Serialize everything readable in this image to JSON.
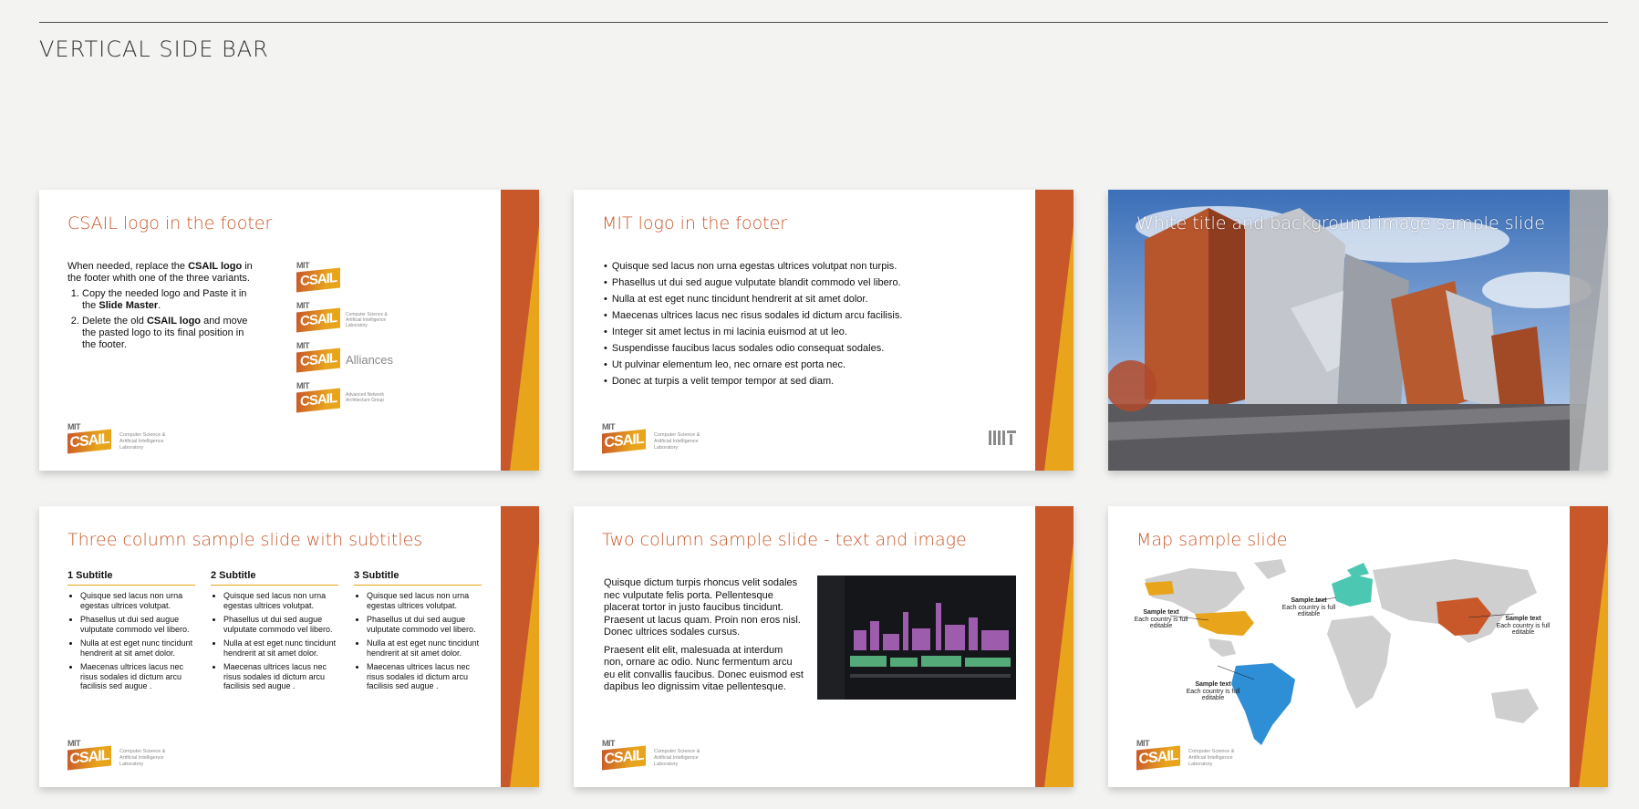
{
  "page": {
    "heading": "VERTICAL SIDE BAR"
  },
  "sidebar": {
    "colors": {
      "orange": "#c8582a",
      "yellow": "#e8a51c",
      "gray": "#a7a9ab"
    }
  },
  "logo": {
    "mit": "MIT",
    "csail": "CSAIL",
    "tagline": [
      "Computer Science &",
      "Artificial Intelligence",
      "Laboratory"
    ],
    "alliances": "Alliances",
    "advanced": [
      "Advanced Network",
      "Architecture Group"
    ]
  },
  "slides": {
    "s1": {
      "title": "CSAIL logo in the footer",
      "intro_pre": "When needed, replace the ",
      "intro_bold": "CSAIL logo",
      "intro_post": " in the footer whith one of the three variants.",
      "step1_pre": "Copy the needed logo and Paste it in the ",
      "step1_bold": "Slide Master",
      "step1_post": ".",
      "step2_pre": "Delete the old ",
      "step2_bold": "CSAIL logo",
      "step2_post": " and move the pasted logo to its final position in the footer."
    },
    "s2": {
      "title": "MIT logo in the footer",
      "bullets": [
        "Quisque sed lacus non urna egestas ultrices volutpat non turpis.",
        "Phasellus ut dui sed augue vulputate blandit commodo vel libero.",
        "Nulla at est eget nunc tincidunt hendrerit at sit amet dolor.",
        "Maecenas ultrices lacus nec risus sodales id dictum arcu facilisis.",
        "Integer sit amet lectus in mi lacinia euismod at ut leo.",
        "Suspendisse faucibus lacus sodales odio consequat sodales.",
        "Ut pulvinar elementum leo, nec ornare est porta nec.",
        "Donec at turpis a velit tempor tempor at sed diam."
      ]
    },
    "s3": {
      "title": "White title and background image sample slide"
    },
    "s4": {
      "title": "Three column sample slide with subtitles",
      "columns": [
        {
          "heading": "1 Subtitle",
          "items": [
            "Quisque sed lacus non urna egestas ultrices volutpat.",
            "Phasellus ut dui sed augue vulputate commodo vel libero.",
            "Nulla at est eget nunc tincidunt hendrerit at sit amet dolor.",
            "Maecenas ultrices lacus nec risus sodales id dictum arcu facilisis sed augue ."
          ]
        },
        {
          "heading": "2 Subtitle",
          "items": [
            "Quisque sed lacus non urna egestas ultrices volutpat.",
            "Phasellus ut dui sed augue vulputate commodo vel libero.",
            "Nulla at est eget nunc tincidunt hendrerit at sit amet dolor.",
            "Maecenas ultrices lacus nec risus sodales id dictum arcu facilisis sed augue ."
          ]
        },
        {
          "heading": "3 Subtitle",
          "items": [
            "Quisque sed lacus non urna egestas ultrices volutpat.",
            "Phasellus ut dui sed augue vulputate commodo vel libero.",
            "Nulla at est eget nunc tincidunt hendrerit at sit amet dolor.",
            "Maecenas ultrices lacus nec risus sodales id dictum arcu facilisis sed augue ."
          ]
        }
      ]
    },
    "s5": {
      "title": "Two column sample slide - text and image",
      "para1": "Quisque dictum turpis rhoncus velit sodales nec vulputate felis porta. Pellentesque placerat tortor in justo faucibus tincidunt. Praesent ut lacus quam. Proin non eros nisl. Donec ultrices sodales cursus.",
      "para2": "Praesent elit elit, malesuada at interdum non, ornare ac odio. Nunc fermentum arcu eu elit convallis faucibus. Donec euismod est dapibus leo dignissim vitae pellentesque."
    },
    "s6": {
      "title": "Map sample slide",
      "labels": [
        {
          "bold": "Sample text",
          "text": "Each country is full editable"
        },
        {
          "bold": "Sample text",
          "text": "Each country is full editable"
        },
        {
          "bold": "Sample text",
          "text": "Each country is full editable"
        },
        {
          "bold": "Sample text",
          "text": "Each country is full editable"
        }
      ]
    }
  }
}
